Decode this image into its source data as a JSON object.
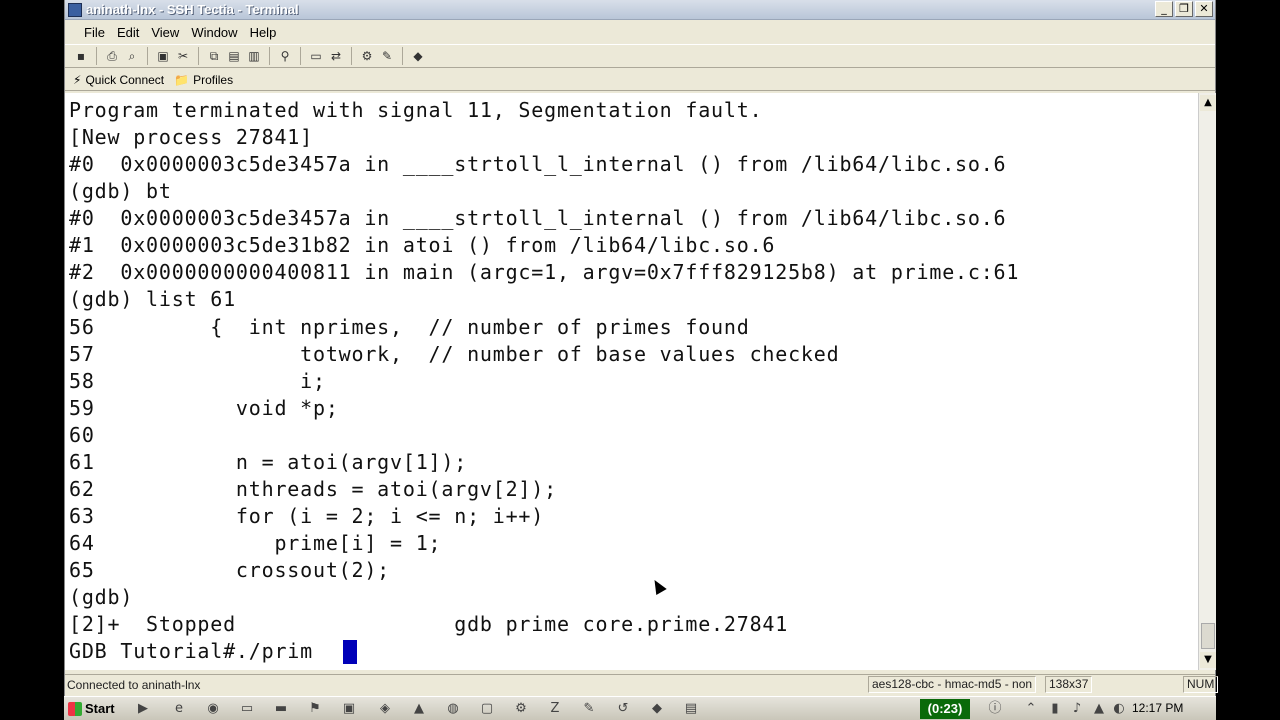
{
  "window": {
    "title": "aninath-lnx - SSH Tectia - Terminal",
    "buttons": [
      "minimize",
      "restore",
      "close"
    ]
  },
  "menubar": {
    "items": [
      "File",
      "Edit",
      "View",
      "Window",
      "Help"
    ]
  },
  "toolbar": {
    "icons": [
      "save-icon",
      "print-icon",
      "print-preview-icon",
      "new-connection-icon",
      "disconnect-icon",
      "copy-icon",
      "paste-icon",
      "paste-all-icon",
      "find-icon",
      "new-terminal-icon",
      "new-file-transfer-icon",
      "settings-icon",
      "profile-settings-icon",
      "help-icon"
    ]
  },
  "profilebar": {
    "quick_connect": "Quick Connect",
    "profiles": "Profiles"
  },
  "terminal": {
    "lines": [
      "Program terminated with signal 11, Segmentation fault.",
      "[New process 27841]",
      "#0  0x0000003c5de3457a in ____strtoll_l_internal () from /lib64/libc.so.6",
      "(gdb) bt",
      "#0  0x0000003c5de3457a in ____strtoll_l_internal () from /lib64/libc.so.6",
      "#1  0x0000003c5de31b82 in atoi () from /lib64/libc.so.6",
      "#2  0x0000000000400811 in main (argc=1, argv=0x7fff829125b8) at prime.c:61",
      "(gdb) list 61",
      "56         {  int nprimes,  // number of primes found",
      "57                totwork,  // number of base values checked",
      "58                i;",
      "59           void *p;",
      "60",
      "61           n = atoi(argv[1]);",
      "62           nthreads = atoi(argv[2]);",
      "63           for (i = 2; i <= n; i++)",
      "64              prime[i] = 1;",
      "65           crossout(2);",
      "(gdb)",
      "[2]+  Stopped                 gdb prime core.prime.27841",
      "GDB Tutorial#./prim"
    ]
  },
  "statusbar": {
    "connection": "Connected to aninath-lnx",
    "cipher": "aes128-cbc - hmac-md5 - non",
    "size": "138x37",
    "num": "NUM"
  },
  "taskbar": {
    "start_label": "Start",
    "timer": "(0:23)",
    "clock": "12:17 PM"
  }
}
